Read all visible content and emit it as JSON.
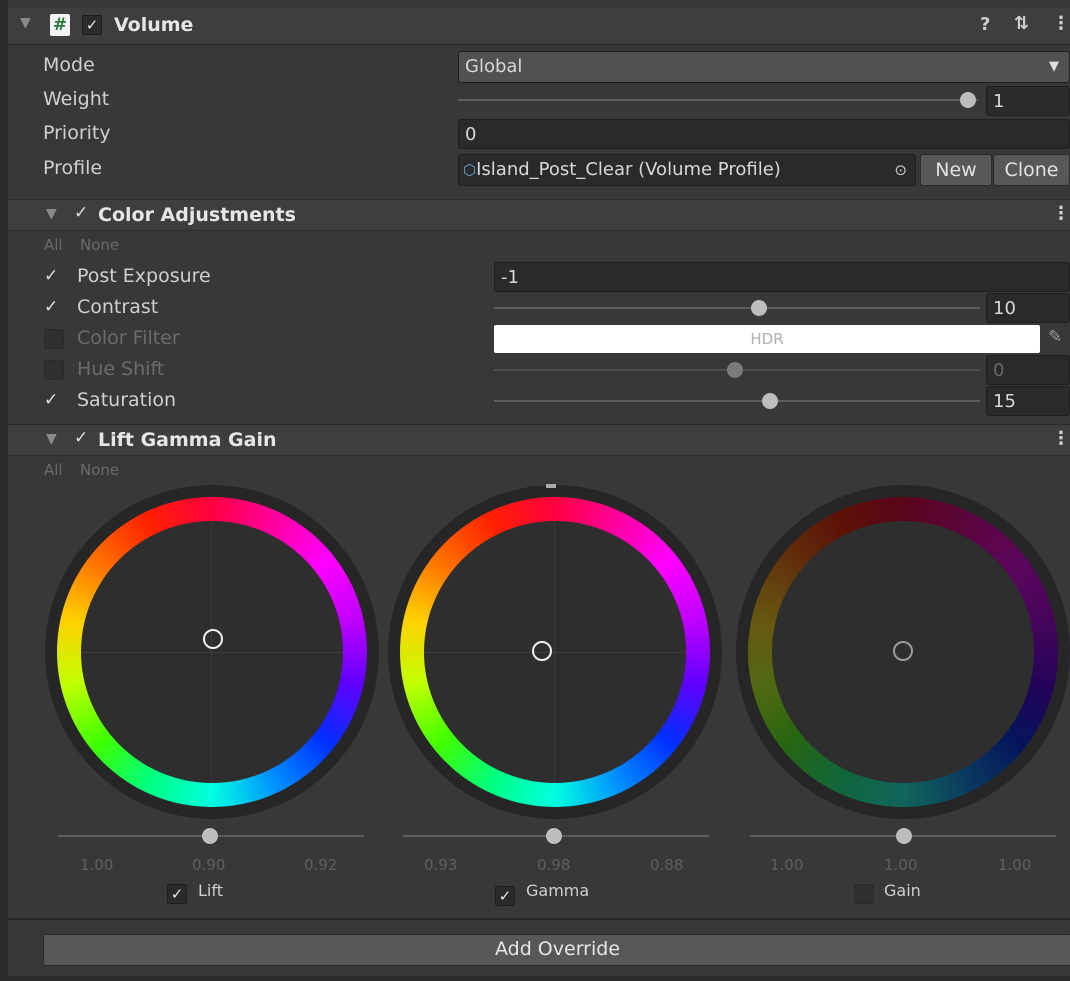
{
  "component": {
    "title": "Volume",
    "enabled": true
  },
  "header_icons": [
    "help-icon",
    "preset-icon",
    "kebab-menu-icon"
  ],
  "fields": {
    "mode": {
      "label": "Mode",
      "value": "Global"
    },
    "weight": {
      "label": "Weight",
      "value": "1",
      "slider": 1.0
    },
    "priority": {
      "label": "Priority",
      "value": "0"
    },
    "profile": {
      "label": "Profile",
      "value": "Island_Post_Clear (Volume Profile)",
      "new_label": "New",
      "clone_label": "Clone"
    }
  },
  "color_adjustments": {
    "title": "Color Adjustments",
    "all_label": "All",
    "none_label": "None",
    "post_exposure": {
      "label": "Post Exposure",
      "value": "-1",
      "checked": true
    },
    "contrast": {
      "label": "Contrast",
      "value": "10",
      "checked": true
    },
    "color_filter": {
      "label": "Color Filter",
      "value": "HDR",
      "checked": false
    },
    "hue_shift": {
      "label": "Hue Shift",
      "value": "0",
      "checked": false
    },
    "saturation": {
      "label": "Saturation",
      "value": "15",
      "checked": true
    }
  },
  "lift_gamma_gain": {
    "title": "Lift Gamma Gain",
    "all_label": "All",
    "none_label": "None",
    "wheels": [
      {
        "name": "Lift",
        "checked": true,
        "values": [
          "1.00",
          "0.90",
          "0.92"
        ]
      },
      {
        "name": "Gamma",
        "checked": true,
        "values": [
          "0.93",
          "0.98",
          "0.88"
        ]
      },
      {
        "name": "Gain",
        "checked": false,
        "values": [
          "1.00",
          "1.00",
          "1.00"
        ]
      }
    ]
  },
  "add_override_label": "Add Override",
  "colors": {
    "background": "#383838",
    "field": "#2a2a2a",
    "button": "#585858"
  }
}
